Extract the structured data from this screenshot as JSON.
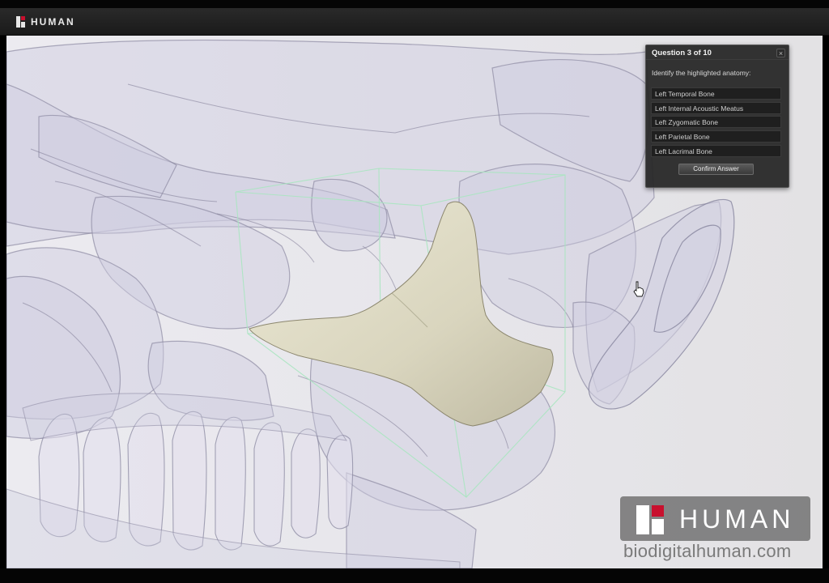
{
  "app": {
    "brand": "HUMAN"
  },
  "quiz": {
    "title": "Question 3 of 10",
    "close_glyph": "×",
    "prompt": "Identify the highlighted anatomy:",
    "options": [
      {
        "label": "Left Temporal Bone"
      },
      {
        "label": "Left Internal Acoustic Meatus"
      },
      {
        "label": "Left Zygomatic Bone"
      },
      {
        "label": "Left Parietal Bone"
      },
      {
        "label": "Left Lacrimal Bone"
      }
    ],
    "confirm_label": "Confirm Answer"
  },
  "watermark": {
    "brand": "HUMAN",
    "url": "biodigitalhuman.com"
  },
  "colors": {
    "brand_red": "#c8102e",
    "highlight_bone": "#dcd8c2",
    "skull_tint": "#d8d6e4",
    "bounding_box": "#a8e6c0"
  },
  "icons": {
    "close": "close-icon",
    "cursor": "hand-cursor-icon",
    "logo": "human-logo-icon"
  }
}
